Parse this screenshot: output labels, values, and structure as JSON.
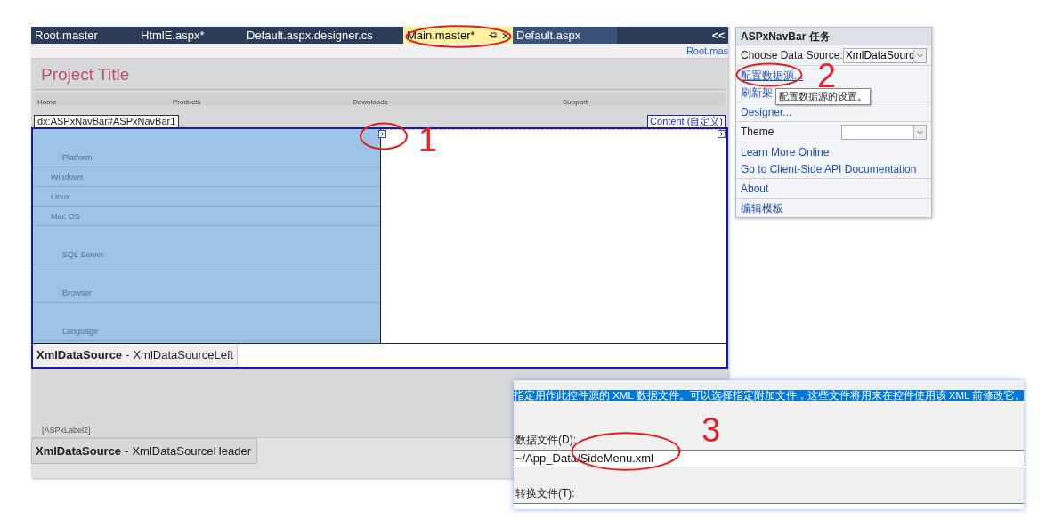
{
  "editor": {
    "tabs": [
      {
        "label": "Root.master",
        "selected": false
      },
      {
        "label": "HtmlE.aspx*",
        "selected": false
      },
      {
        "label": "Default.aspx.designer.cs",
        "selected": false
      },
      {
        "label": "Main.master*",
        "selected": true
      },
      {
        "label": "Default.aspx",
        "selected": false
      }
    ],
    "overflow_glyph": "<<",
    "breadcrumb": "Root.mas",
    "page": {
      "title": "Project Title",
      "menu": [
        "Home",
        "Products",
        "Downloads",
        "Support"
      ],
      "navbar_tag": "dx:ASPxNavBar#ASPxNavBar1",
      "content_tag": "Content (自定义)",
      "navbar_items": [
        {
          "text": "Platform",
          "kind": "group"
        },
        {
          "text": "Windows",
          "kind": "item"
        },
        {
          "text": "Linux",
          "kind": "item"
        },
        {
          "text": "Mac OS",
          "kind": "item"
        },
        {
          "text": "SQL Server",
          "kind": "group"
        },
        {
          "text": "Browser",
          "kind": "group"
        },
        {
          "text": "Language",
          "kind": "group"
        }
      ],
      "datasource_left": {
        "type": "XmlDataSource",
        "separator": "-",
        "name": "XmlDataSourceLeft"
      },
      "label": "[ASPxLabel2]",
      "datasource_header": {
        "type": "XmlDataSource",
        "separator": "-",
        "name": "XmlDataSourceHeader"
      }
    }
  },
  "tasks_panel": {
    "title": "ASPxNavBar 任务",
    "sections": [
      [
        {
          "kind": "dropdown",
          "label": "Choose Data Source:",
          "value": "XmlDataSourc"
        }
      ],
      [
        {
          "kind": "link",
          "text": "配置数据源..."
        },
        {
          "kind": "link",
          "text": "刷新架"
        }
      ],
      [
        {
          "kind": "link",
          "text": "Designer..."
        }
      ],
      [
        {
          "kind": "dropdown",
          "label": "Theme"
        }
      ],
      [
        {
          "kind": "link",
          "text": "Learn More Online"
        },
        {
          "kind": "link",
          "text": "Go to Client-Side API Documentation"
        }
      ],
      [
        {
          "kind": "link",
          "text": "About"
        }
      ],
      [
        {
          "kind": "link",
          "text": "编辑模板"
        }
      ]
    ],
    "tooltip": "配置数据源的设置。"
  },
  "dialog": {
    "description": "指定用作此控件源的 XML 数据文件。可以选择指定附加文件，这些文件将用来在控件使用该 XML 前修改它。",
    "fields": [
      {
        "label": "数据文件(D):",
        "value": "~/App_Data/SideMenu.xml"
      },
      {
        "label": "转换文件(T):"
      }
    ]
  },
  "annotations": [
    {
      "text": "1"
    },
    {
      "text": "2"
    },
    {
      "text": "3"
    }
  ]
}
